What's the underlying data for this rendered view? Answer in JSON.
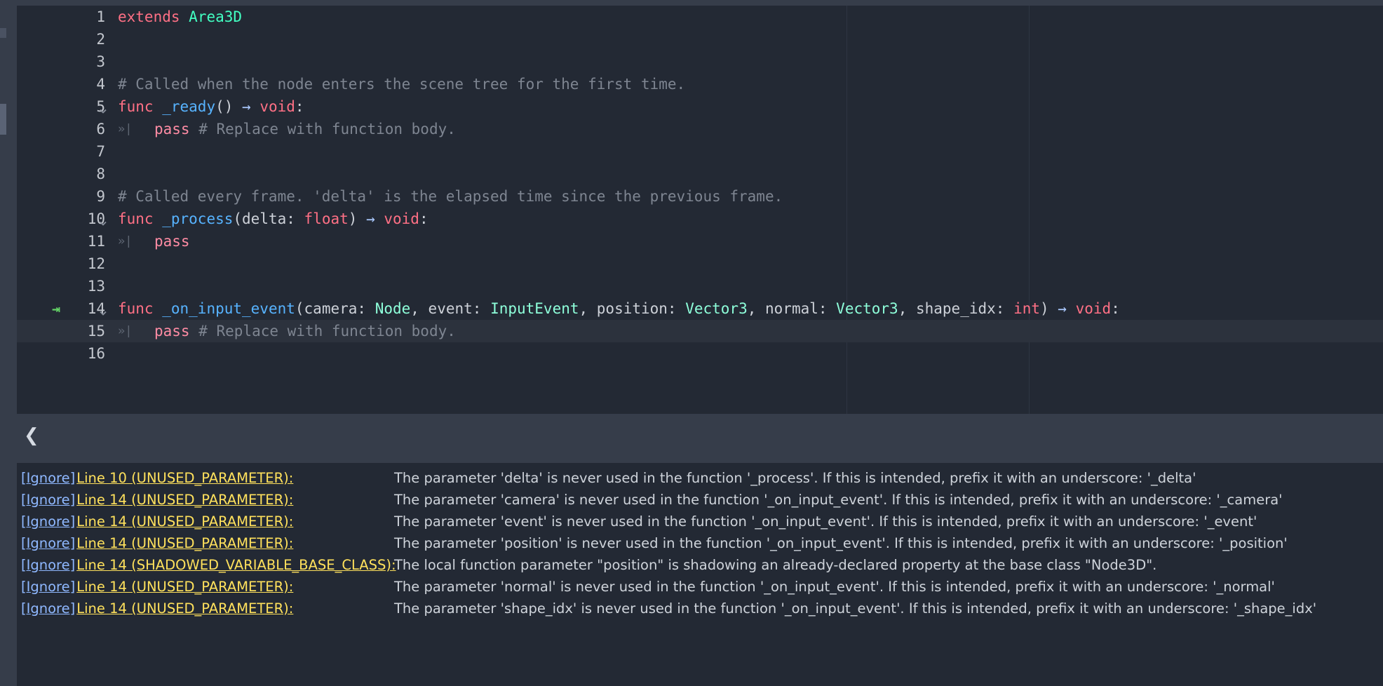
{
  "editor": {
    "lines": [
      {
        "n": "1",
        "tokens": [
          [
            "kw",
            "extends"
          ],
          [
            "pl",
            " "
          ],
          [
            "ty",
            "Area3D"
          ]
        ]
      },
      {
        "n": "2",
        "tokens": []
      },
      {
        "n": "3",
        "tokens": []
      },
      {
        "n": "4",
        "tokens": [
          [
            "cm",
            "# Called when the node enters the scene tree for the first time."
          ]
        ]
      },
      {
        "n": "5",
        "fold": true,
        "tokens": [
          [
            "kw",
            "func"
          ],
          [
            "pl",
            " "
          ],
          [
            "fn",
            "_ready"
          ],
          [
            "pl",
            "() "
          ],
          [
            "op",
            "→"
          ],
          [
            "pl",
            " "
          ],
          [
            "kw",
            "void"
          ],
          [
            "pl",
            ":"
          ]
        ]
      },
      {
        "n": "6",
        "indent": true,
        "tokens": [
          [
            "kw2",
            "pass"
          ],
          [
            "pl",
            " "
          ],
          [
            "cm",
            "# Replace with function body."
          ]
        ]
      },
      {
        "n": "7",
        "tokens": []
      },
      {
        "n": "8",
        "tokens": []
      },
      {
        "n": "9",
        "tokens": [
          [
            "cm",
            "# Called every frame. 'delta' is the elapsed time since the previous frame."
          ]
        ]
      },
      {
        "n": "10",
        "fold": true,
        "tokens": [
          [
            "kw",
            "func"
          ],
          [
            "pl",
            " "
          ],
          [
            "fn",
            "_process"
          ],
          [
            "pl",
            "(delta: "
          ],
          [
            "kw",
            "float"
          ],
          [
            "pl",
            ") "
          ],
          [
            "op",
            "→"
          ],
          [
            "pl",
            " "
          ],
          [
            "kw",
            "void"
          ],
          [
            "pl",
            ":"
          ]
        ]
      },
      {
        "n": "11",
        "indent": true,
        "tokens": [
          [
            "kw2",
            "pass"
          ]
        ]
      },
      {
        "n": "12",
        "tokens": []
      },
      {
        "n": "13",
        "tokens": []
      },
      {
        "n": "14",
        "fold": true,
        "bookmark": true,
        "tokens": [
          [
            "kw",
            "func"
          ],
          [
            "pl",
            " "
          ],
          [
            "fn",
            "_on_input_event"
          ],
          [
            "pl",
            "(camera: "
          ],
          [
            "ty2",
            "Node"
          ],
          [
            "pl",
            ", event: "
          ],
          [
            "ty2",
            "InputEvent"
          ],
          [
            "pl",
            ", position: "
          ],
          [
            "ty2",
            "Vector3"
          ],
          [
            "pl",
            ", normal: "
          ],
          [
            "ty2",
            "Vector3"
          ],
          [
            "pl",
            ", shape_idx: "
          ],
          [
            "kw",
            "int"
          ],
          [
            "pl",
            ") "
          ],
          [
            "op",
            "→"
          ],
          [
            "pl",
            " "
          ],
          [
            "kw",
            "void"
          ],
          [
            "pl",
            ":"
          ]
        ]
      },
      {
        "n": "15",
        "indent": true,
        "current": true,
        "tokens": [
          [
            "kw2",
            "pass"
          ],
          [
            "pl",
            " "
          ],
          [
            "cm",
            "# Replace with function body."
          ]
        ]
      },
      {
        "n": "16",
        "tokens": []
      }
    ],
    "tab_marker": "»|",
    "bookmark_icon": "⇥"
  },
  "panel": {
    "collapse_label": "❮"
  },
  "warnings": [
    {
      "ignore": "[Ignore]",
      "link": "Line 10 (UNUSED_PARAMETER):",
      "message": "The parameter 'delta' is never used in the function '_process'. If this is intended, prefix it with an underscore: '_delta'"
    },
    {
      "ignore": "[Ignore]",
      "link": "Line 14 (UNUSED_PARAMETER):",
      "message": "The parameter 'camera' is never used in the function '_on_input_event'. If this is intended, prefix it with an underscore: '_camera'"
    },
    {
      "ignore": "[Ignore]",
      "link": "Line 14 (UNUSED_PARAMETER):",
      "message": "The parameter 'event' is never used in the function '_on_input_event'. If this is intended, prefix it with an underscore: '_event'"
    },
    {
      "ignore": "[Ignore]",
      "link": "Line 14 (UNUSED_PARAMETER):",
      "message": "The parameter 'position' is never used in the function '_on_input_event'. If this is intended, prefix it with an underscore: '_position'"
    },
    {
      "ignore": "[Ignore]",
      "link": "Line 14 (SHADOWED_VARIABLE_BASE_CLASS):",
      "message": "The local function parameter \"position\" is shadowing an already-declared property at the base class \"Node3D\"."
    },
    {
      "ignore": "[Ignore]",
      "link": "Line 14 (UNUSED_PARAMETER):",
      "message": "The parameter 'normal' is never used in the function '_on_input_event'. If this is intended, prefix it with an underscore: '_normal'"
    },
    {
      "ignore": "[Ignore]",
      "link": "Line 14 (UNUSED_PARAMETER):",
      "message": "The parameter 'shape_idx' is never used in the function '_on_input_event'. If this is intended, prefix it with an underscore: '_shape_idx'"
    }
  ],
  "colors": {
    "editor_bg": "#232934",
    "panel_bg": "#363d4a",
    "keyword": "#ff7085",
    "type": "#42ffc2",
    "function": "#57b3ff",
    "comment": "#7e8591",
    "warning_link": "#ffe15c",
    "ignore_link": "#8fb8ff"
  }
}
